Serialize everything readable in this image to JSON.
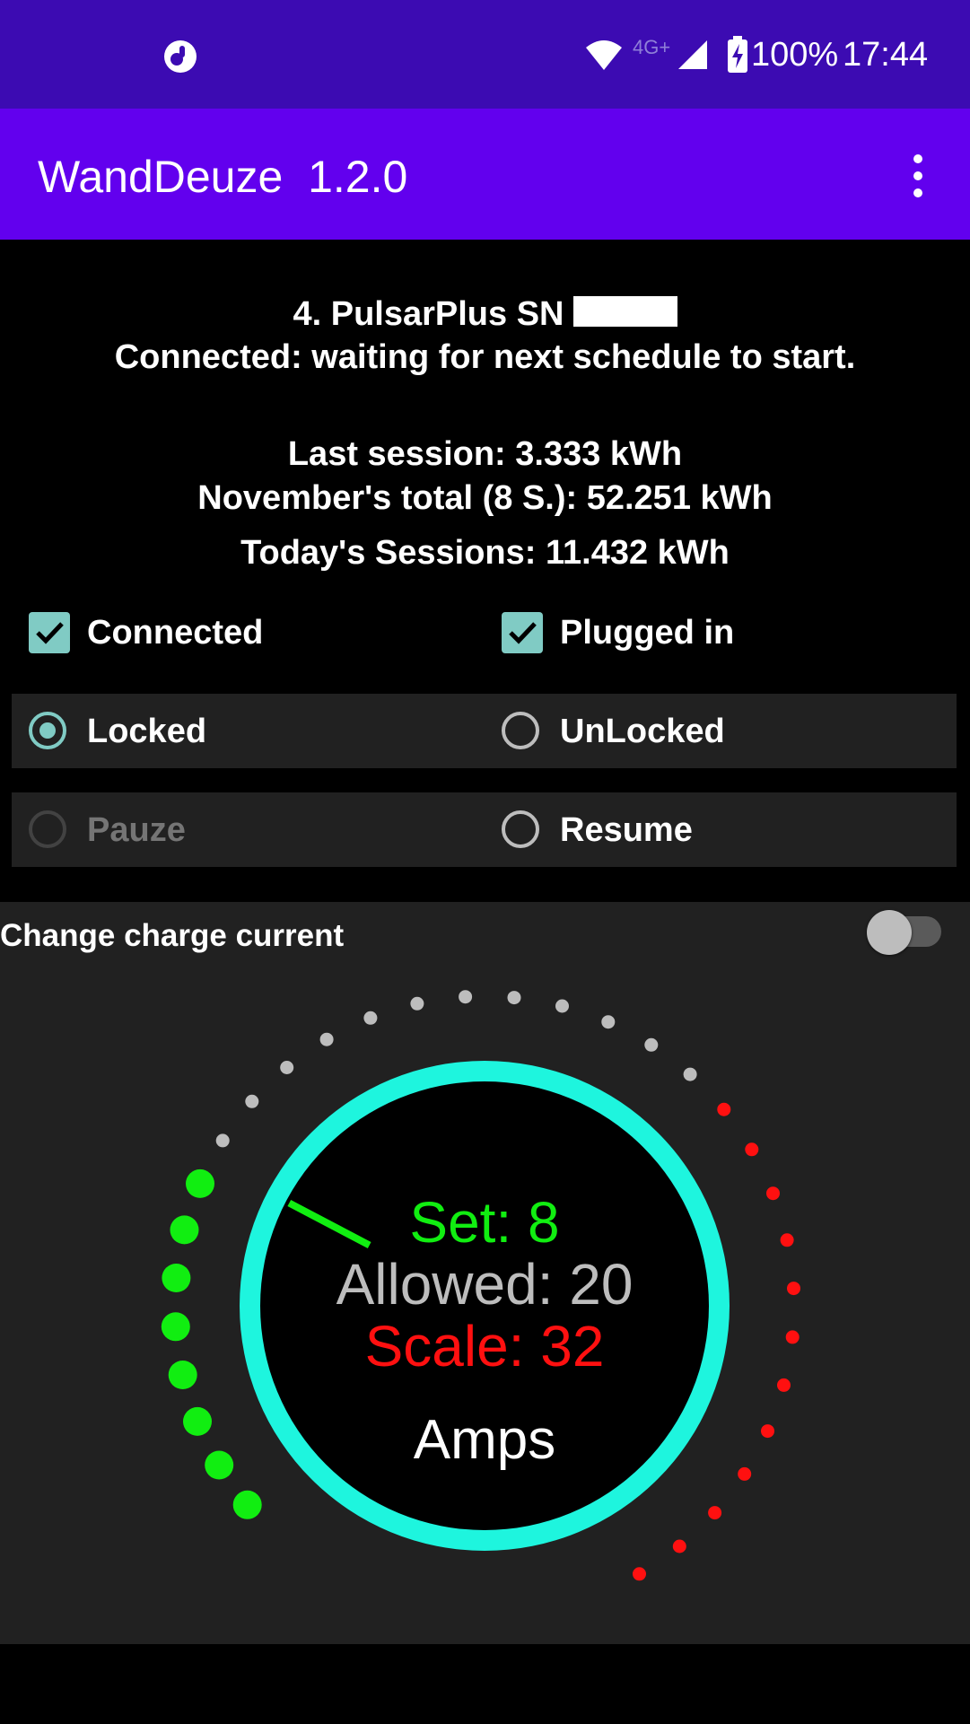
{
  "status_bar": {
    "battery": "100%",
    "time": "17:44",
    "network": "4G+"
  },
  "app_bar": {
    "title": "WandDeuze  1.2.0"
  },
  "charger": {
    "name_line": "4.   PulsarPlus SN",
    "status": "Connected: waiting for next schedule to start."
  },
  "stats": {
    "last_session": "Last session: 3.333 kWh",
    "month_total": "November's total (8 S.): 52.251 kWh",
    "today": "Today's Sessions: 11.432 kWh"
  },
  "checks": {
    "connected": "Connected",
    "plugged_in": "Plugged in"
  },
  "lock_radio": {
    "locked": "Locked",
    "unlocked": "UnLocked",
    "selected": "Locked"
  },
  "pause_radio": {
    "pause": "Pauze",
    "resume": "Resume"
  },
  "current": {
    "switch_label": "Change charge current",
    "switch_on": false,
    "set_text": "Set: 8",
    "allowed_text": "Allowed: 20",
    "scale_text": "Scale: 32",
    "unit_text": "Amps",
    "set": 8,
    "allowed": 20,
    "scale": 32
  },
  "colors": {
    "status_bar": "#3c0bb2",
    "app_bar": "#6200ee",
    "accent": "#80cbc4",
    "ring": "#1ef5de",
    "set": "#11ee11",
    "allowed": "#bdbdbd",
    "scale": "#ff1010"
  }
}
